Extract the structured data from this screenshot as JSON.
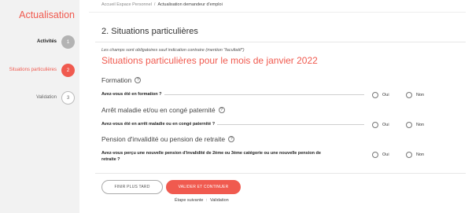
{
  "sidebar": {
    "title": "Actualisation",
    "steps": [
      {
        "label": "Activités",
        "number": "1",
        "state": "done"
      },
      {
        "label": "Situations particulières",
        "number": "2",
        "state": "active"
      },
      {
        "label": "Validation",
        "number": "3",
        "state": "todo"
      }
    ]
  },
  "breadcrumb": {
    "home": "Accueil Espace Personnel",
    "separator": "/",
    "current": "Actualisation demandeur d'emploi"
  },
  "section_title": "2. Situations particulières",
  "required_note": "Les champs sont obligatoires sauf indication contraire (mention \"facultatif\")",
  "month_title": "Situations particulières pour le mois de janvier 2022",
  "help_icon": "?",
  "groups": [
    {
      "title": "Formation",
      "question": "Avez-vous été en formation  ?",
      "options": [
        "Oui",
        "Non"
      ]
    },
    {
      "title": "Arrêt maladie et/ou en congé paternité",
      "question": "Avez-vous été en arrêt maladie ou en congé paternité ?",
      "options": [
        "Oui",
        "Non"
      ]
    },
    {
      "title": "Pension d'invalidité ou pension de retraite",
      "question_line1": "Avez-vous perçu une nouvelle pension d'invalidité de 2ème ou 3ème catégorie ou une nouvelle pension de",
      "question_line2": "retraite ?",
      "options": [
        "Oui",
        "Non"
      ]
    }
  ],
  "buttons": {
    "later": "Finir plus tard",
    "continue": "Valider et continuer"
  },
  "next_step": {
    "label": "Étape suivante",
    "separator": ":",
    "value": "Validation"
  },
  "colors": {
    "accent": "#f05a4f",
    "sidebar_bg": "#f2f2f2"
  }
}
